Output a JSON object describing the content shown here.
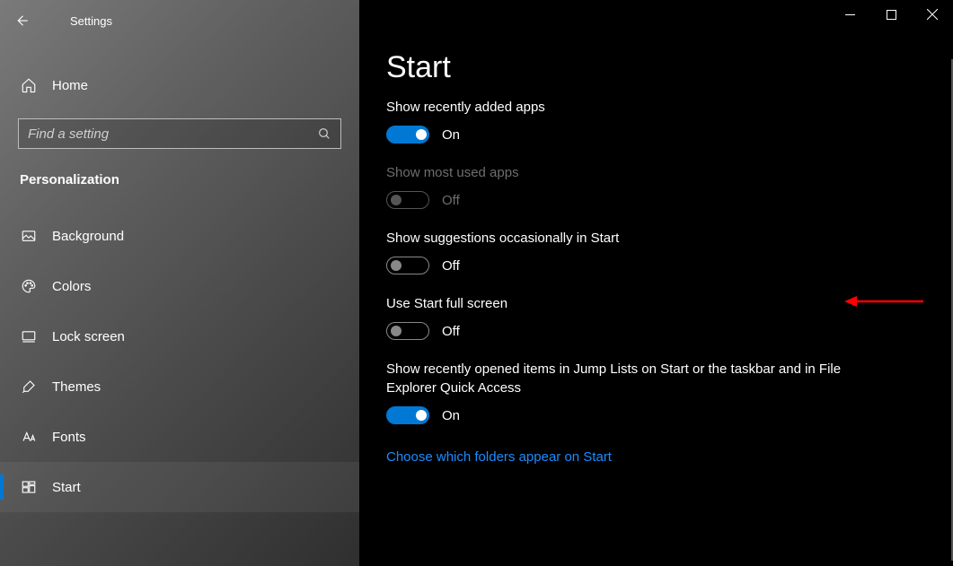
{
  "window": {
    "title": "Settings"
  },
  "sidebar": {
    "home": "Home",
    "search_placeholder": "Find a setting",
    "category": "Personalization",
    "items": [
      {
        "label": "Background"
      },
      {
        "label": "Colors"
      },
      {
        "label": "Lock screen"
      },
      {
        "label": "Themes"
      },
      {
        "label": "Fonts"
      },
      {
        "label": "Start"
      }
    ]
  },
  "page": {
    "title": "Start",
    "link": "Choose which folders appear on Start",
    "toggle_on_text": "On",
    "toggle_off_text": "Off",
    "settings": [
      {
        "label": "Show recently added apps",
        "state": "On",
        "on": true,
        "disabled": false
      },
      {
        "label": "Show most used apps",
        "state": "Off",
        "on": false,
        "disabled": true
      },
      {
        "label": "Show suggestions occasionally in Start",
        "state": "Off",
        "on": false,
        "disabled": false
      },
      {
        "label": "Use Start full screen",
        "state": "Off",
        "on": false,
        "disabled": false
      },
      {
        "label": "Show recently opened items in Jump Lists on Start or the taskbar and in File Explorer Quick Access",
        "state": "On",
        "on": true,
        "disabled": false
      }
    ]
  }
}
